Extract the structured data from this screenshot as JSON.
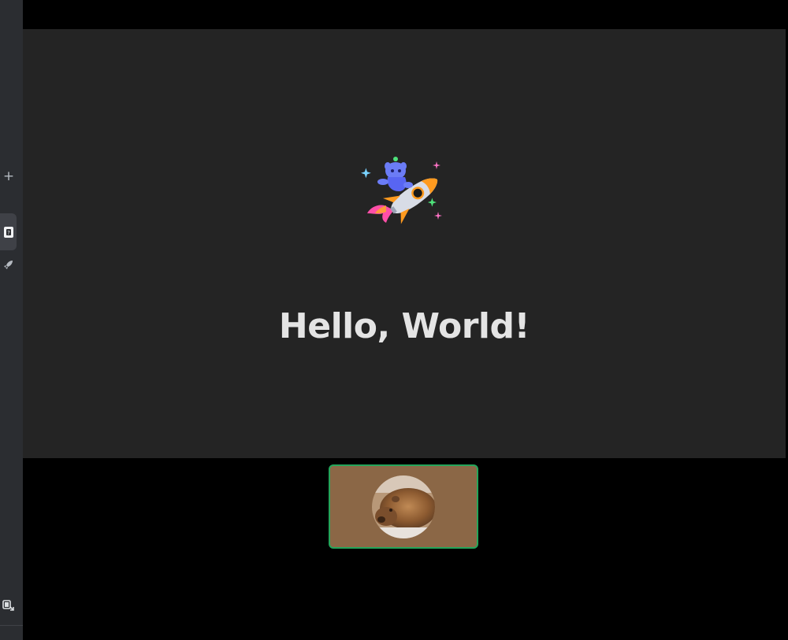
{
  "rail": {
    "add_icon": "plus-icon",
    "active_icon": "dice-icon",
    "launch_icon": "rocket-icon",
    "popout_icon": "popout-icon"
  },
  "stage": {
    "mascot_icon": "wumpus-rocket-illustration",
    "greeting": "Hello, World!"
  },
  "participants": [
    {
      "avatar_icon": "capybara-avatar",
      "speaking": true,
      "tile_color": "#8b6746"
    }
  ],
  "colors": {
    "rail_bg": "#2b2d31",
    "stage_bg": "#242424",
    "speaking_ring": "#23a55a",
    "text": "#e4e4e4"
  }
}
